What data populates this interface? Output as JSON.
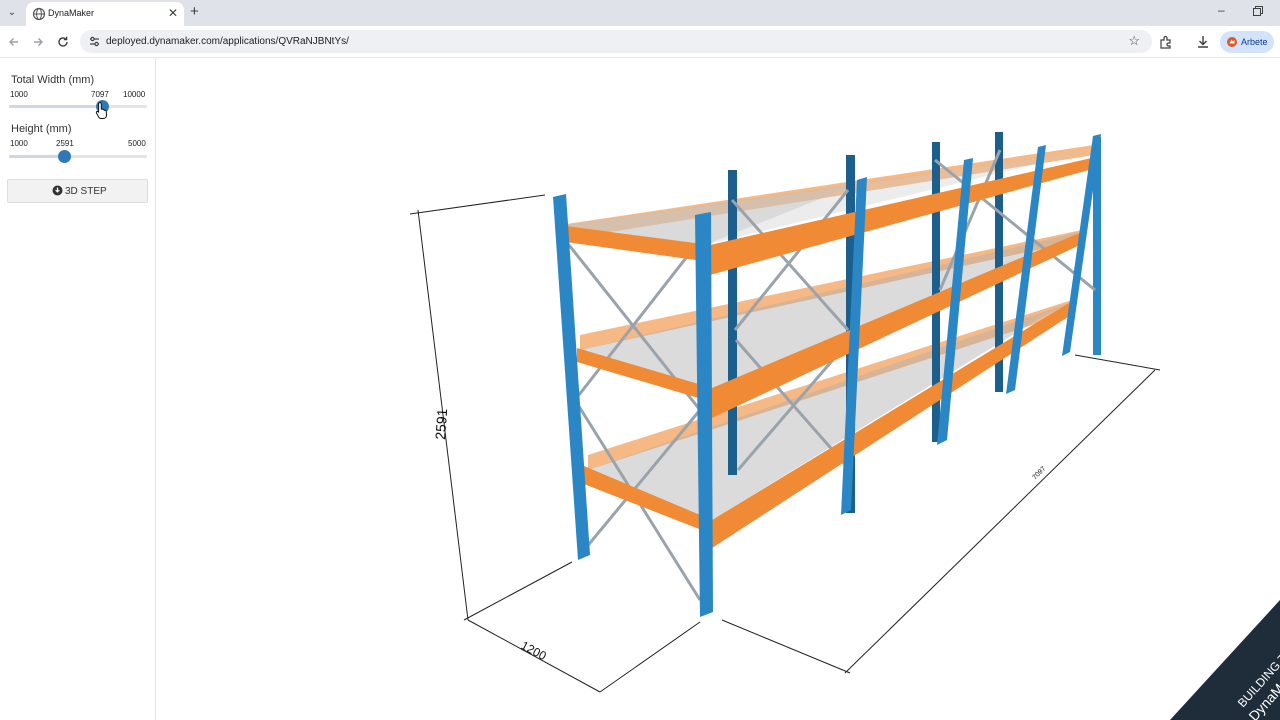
{
  "browser": {
    "tab_title": "DynaMaker",
    "url": "deployed.dynamaker.com/applications/QVRaNJBNtYs/",
    "profile_name": "Arbete",
    "new_tab_symbol": "+",
    "close_symbol": "✕"
  },
  "sidebar": {
    "width_label": "Total Width (mm)",
    "width_min": "1000",
    "width_value": "7097",
    "width_max": "10000",
    "width_fraction": 0.677,
    "height_label": "Height (mm)",
    "height_min": "1000",
    "height_value": "2591",
    "height_max": "5000",
    "height_fraction": 0.398,
    "step_button_label": "3D STEP"
  },
  "scene": {
    "dimension_height": "2591",
    "dimension_depth": "1200",
    "dimension_length": "7097",
    "upright_color": "#2a86c4",
    "beam_color": "#f08a34",
    "shelf_color": "#bcbcbc"
  },
  "watermark": {
    "line1": "BUILDING TODAY",
    "line2": "DynaMaker"
  }
}
